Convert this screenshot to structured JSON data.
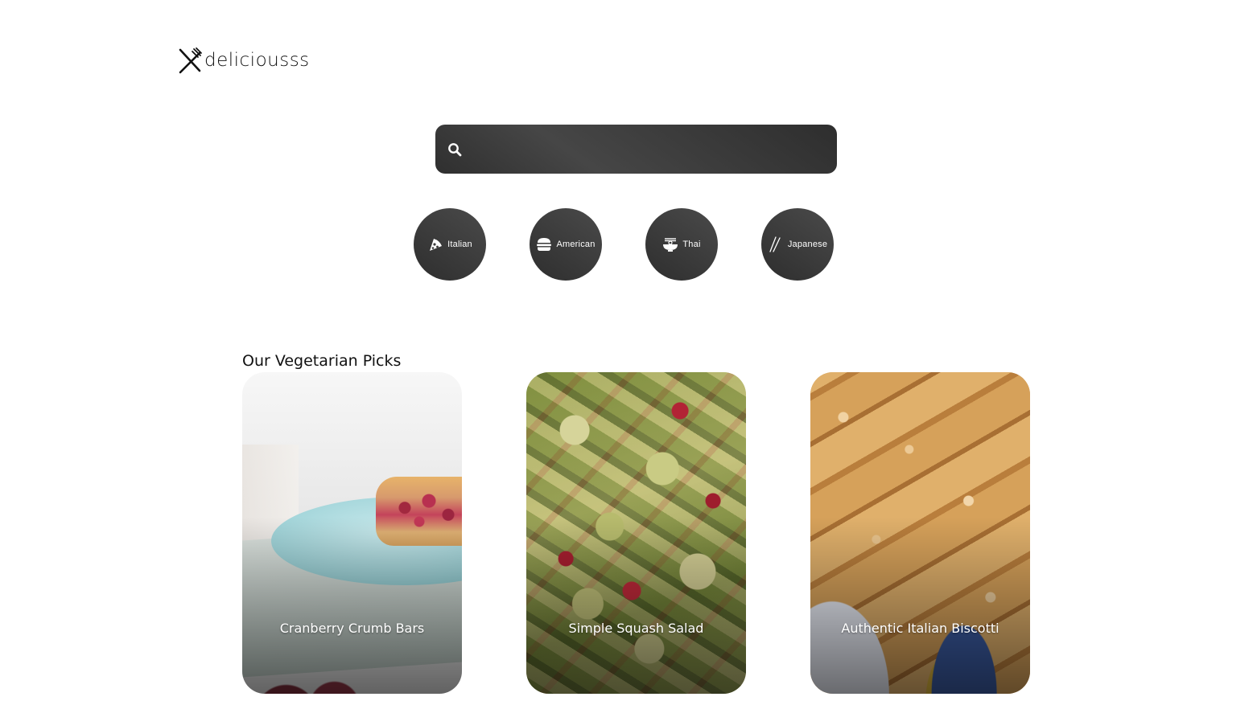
{
  "brand": {
    "name": "deliciousss"
  },
  "search": {
    "value": "",
    "placeholder": ""
  },
  "categories": [
    {
      "label": "Italian",
      "icon": "pizza-icon"
    },
    {
      "label": "American",
      "icon": "burger-icon"
    },
    {
      "label": "Thai",
      "icon": "noodle-bowl-icon"
    },
    {
      "label": "Japanese",
      "icon": "chopsticks-icon"
    }
  ],
  "section": {
    "title": "Our Vegetarian Picks",
    "recipes": [
      {
        "title": "Cranberry Crumb Bars"
      },
      {
        "title": "Simple Squash Salad"
      },
      {
        "title": "Authentic Italian Biscotti"
      }
    ]
  }
}
